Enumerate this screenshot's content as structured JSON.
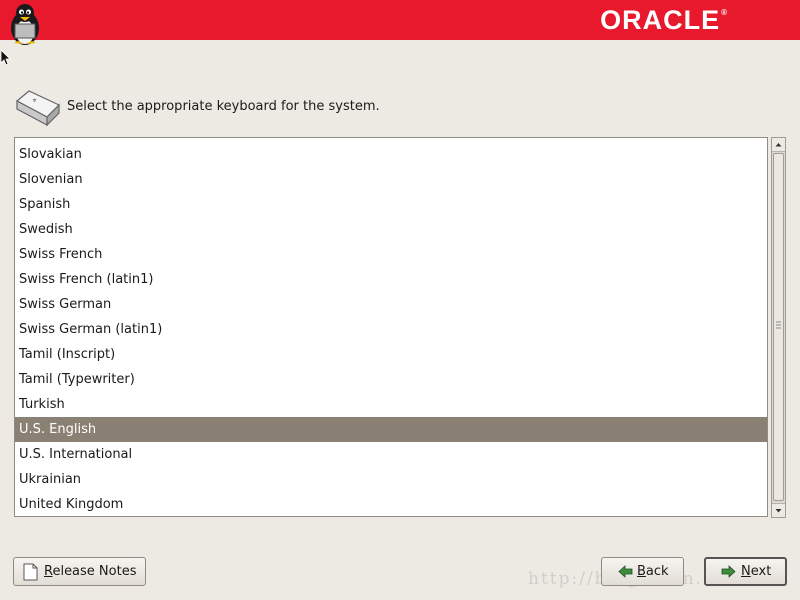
{
  "header": {
    "brand": "ORACLE",
    "trademark": "®",
    "accent_color": "#e8192c"
  },
  "prompt": "Select the appropriate keyboard for the system.",
  "keyboard_list": {
    "items": [
      "Slovakian",
      "Slovenian",
      "Spanish",
      "Swedish",
      "Swiss French",
      "Swiss French (latin1)",
      "Swiss German",
      "Swiss German (latin1)",
      "Tamil (Inscript)",
      "Tamil (Typewriter)",
      "Turkish",
      "U.S. English",
      "U.S. International",
      "Ukrainian",
      "United Kingdom"
    ],
    "selected": "U.S. English",
    "selected_color": "#8a8074"
  },
  "buttons": {
    "release_notes": {
      "pre": "",
      "mnemonic": "R",
      "post": "elease Notes"
    },
    "back": {
      "pre": "",
      "mnemonic": "B",
      "post": "ack"
    },
    "next": {
      "pre": "",
      "mnemonic": "N",
      "post": "ext"
    }
  },
  "watermark": "http://blog.csdn.net/..."
}
